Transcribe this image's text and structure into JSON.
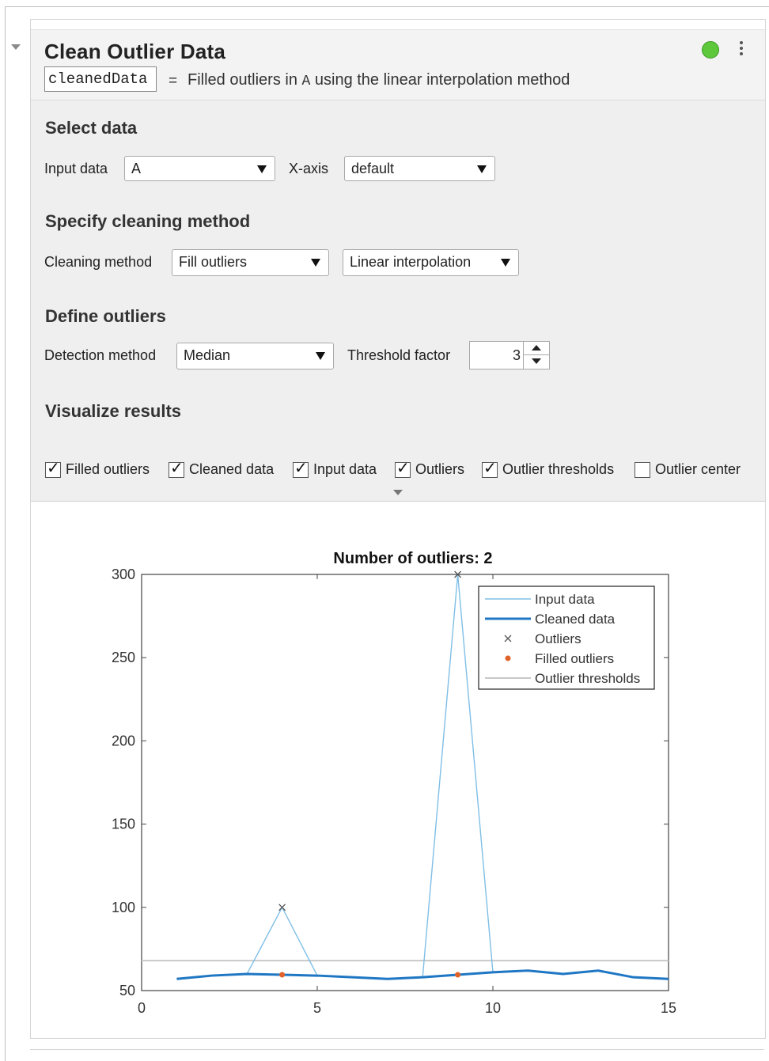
{
  "task": {
    "title": "Clean Outlier Data",
    "output_variable": "cleanedData",
    "equals": "=",
    "summary_prefix": "Filled outliers in ",
    "summary_var": "A",
    "summary_suffix": " using the linear interpolation method",
    "status_color": "#5ec83c"
  },
  "select_data": {
    "heading": "Select data",
    "input_label": "Input data",
    "input_value": "A",
    "xaxis_label": "X-axis",
    "xaxis_value": "default"
  },
  "cleaning": {
    "heading": "Specify cleaning method",
    "method_label": "Cleaning method",
    "method_value": "Fill outliers",
    "fill_value": "Linear interpolation"
  },
  "outliers": {
    "heading": "Define outliers",
    "detection_label": "Detection method",
    "detection_value": "Median",
    "threshold_label": "Threshold factor",
    "threshold_value": "3"
  },
  "visualize": {
    "heading": "Visualize results",
    "options": [
      {
        "label": "Filled outliers",
        "checked": true
      },
      {
        "label": "Cleaned data",
        "checked": true
      },
      {
        "label": "Input data",
        "checked": true
      },
      {
        "label": "Outliers",
        "checked": true
      },
      {
        "label": "Outlier thresholds",
        "checked": true
      },
      {
        "label": "Outlier center",
        "checked": false
      }
    ]
  },
  "chart_data": {
    "type": "line",
    "title": "Number of outliers: 2",
    "xlim": [
      0,
      15
    ],
    "ylim": [
      50,
      300
    ],
    "xticks": [
      "0",
      "5",
      "10",
      "15"
    ],
    "yticks": [
      "50",
      "100",
      "150",
      "200",
      "250",
      "300"
    ],
    "x": [
      1,
      2,
      3,
      4,
      5,
      6,
      7,
      8,
      9,
      10,
      11,
      12,
      13,
      14,
      15
    ],
    "series": [
      {
        "name": "Input data",
        "color": "#7fbfe6",
        "values": [
          57,
          59,
          60,
          100,
          59,
          58,
          57,
          58,
          300,
          61,
          62,
          60,
          62,
          58,
          57
        ]
      },
      {
        "name": "Cleaned data",
        "color": "#1f77c4",
        "values": [
          57,
          59,
          60,
          59.5,
          59,
          58,
          57,
          58,
          59.5,
          61,
          62,
          60,
          62,
          58,
          57
        ]
      }
    ],
    "outliers": {
      "name": "Outliers",
      "x": [
        4,
        9
      ],
      "y": [
        100,
        300
      ]
    },
    "filled_outliers": {
      "name": "Filled outliers",
      "x": [
        4,
        9
      ],
      "y": [
        59.5,
        59.5
      ],
      "color": "#e0612a"
    },
    "threshold": {
      "name": "Outlier thresholds",
      "value": 68,
      "color": "#c8c8c8"
    },
    "legend": [
      "Input data",
      "Cleaned data",
      "Outliers",
      "Filled outliers",
      "Outlier thresholds"
    ],
    "legend_position": "top-right"
  }
}
